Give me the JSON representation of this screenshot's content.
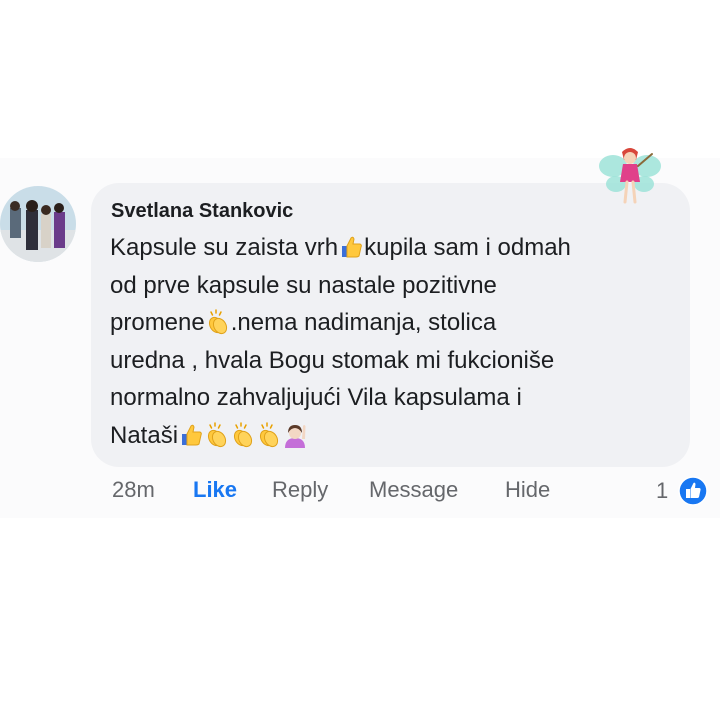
{
  "comment": {
    "author": "Svetlana Stankovic",
    "lines": [
      {
        "parts": [
          "Kapsule su zaista vrh",
          "kupila sam i odmah"
        ],
        "emoji": [
          "thumbs-up-icon"
        ]
      },
      {
        "parts": [
          "od prve kapsule su nastale pozitivne"
        ],
        "emoji": []
      },
      {
        "parts": [
          "promene",
          ".nema nadimanja, stolica"
        ],
        "emoji": [
          "clapping-hands-icon"
        ]
      },
      {
        "parts": [
          "uredna , hvala Bogu stomak mi fukcioniše"
        ],
        "emoji": []
      },
      {
        "parts": [
          "normalno zahvaljujući Vila kapsulama i"
        ],
        "emoji": []
      },
      {
        "parts": [
          "Nataši"
        ],
        "emoji": [
          "thumbs-up-icon",
          "clapping-hands-icon",
          "clapping-hands-icon",
          "clapping-hands-icon",
          "person-raising-hand-icon"
        ]
      }
    ]
  },
  "actions": {
    "time": "28m",
    "like": "Like",
    "reply": "Reply",
    "message": "Message",
    "hide": "Hide"
  },
  "reactions": {
    "count": "1",
    "icon": "like-reaction-icon",
    "color": "#1877f2"
  },
  "decor": {
    "sticker": "fairy-icon"
  },
  "colors": {
    "bubble": "#f0f1f4",
    "text": "#1c1e21",
    "muted": "#65676b",
    "accent": "#1877f2"
  }
}
